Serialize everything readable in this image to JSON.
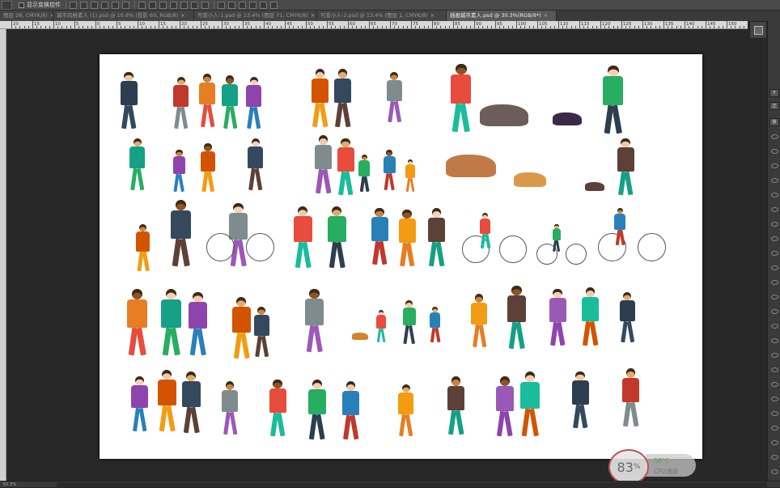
{
  "options_bar": {
    "checkbox_label": "显示变换控件"
  },
  "tabs": [
    {
      "label": "图层 28, CMYK/8)",
      "close": "×"
    },
    {
      "label": "城市风格素人 (1).psd @ 10.8% (投影 60, RGB/8)",
      "close": "×"
    },
    {
      "label": "可爱小人-1.psd @ 13.4% (图层 71, CMYK/8)",
      "close": "×"
    },
    {
      "label": "可爱小人-2.psd @ 13.4% (图层 1, CMYK/8)",
      "close": "×"
    },
    {
      "label": "插画城市素人.psd @ 30.3%(RGB/8*)",
      "close": "×",
      "active": true
    }
  ],
  "ruler_marks": [
    "20",
    "15",
    "10",
    "5",
    "0",
    "5",
    "10",
    "15",
    "20",
    "25",
    "30",
    "35",
    "40",
    "45",
    "50",
    "55",
    "60",
    "65",
    "70",
    "75",
    "80",
    "85",
    "90",
    "95",
    "100",
    "105",
    "110",
    "115",
    "120",
    "125",
    "130",
    "135",
    "140",
    "145",
    "150"
  ],
  "cpu_widget": {
    "percent": "83",
    "percent_sign": "%",
    "temperature": "58℃",
    "label": "CPU温度"
  },
  "status_bar": {
    "zoom_text": "30.3%"
  },
  "right_panel": {
    "btn_1": "P",
    "btn_2": "正",
    "btn_3": "锁"
  },
  "colors": {
    "canvas_bg": "#ffffff",
    "workspace_bg": "#282828",
    "panel_bg": "#3a3a3a"
  }
}
